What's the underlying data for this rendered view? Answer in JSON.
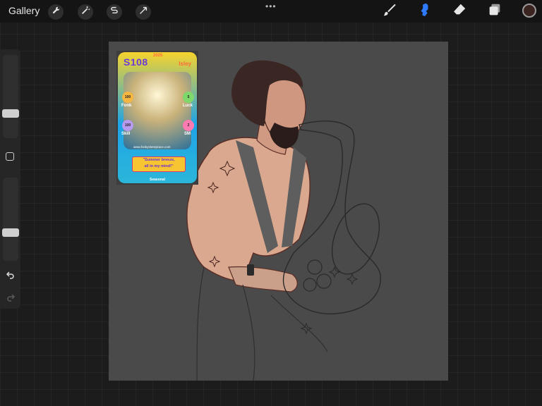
{
  "topbar": {
    "gallery_label": "Gallery",
    "more_dots": "•••"
  },
  "icons": {
    "wrench": "wrench-icon",
    "magic": "magic-wand-icon",
    "selection": "selection-icon",
    "transform": "transform-arrow-icon",
    "brush": "brush-icon",
    "smudge": "smudge-icon",
    "eraser": "eraser-icon",
    "layers": "layers-icon"
  },
  "colors": {
    "active_tool": "#2f7bff",
    "current_color": "#3b2320",
    "canvas": "#4a4a4a"
  },
  "sidebar": {
    "brush_size": 0.55,
    "opacity": 0.65
  },
  "card": {
    "year": "2025",
    "code": "S108",
    "name": "Isley",
    "stats": [
      {
        "value": "100",
        "label": "Fonk",
        "color": "#f5b642"
      },
      {
        "value": "5",
        "label": "Luck",
        "color": "#7fd86b"
      },
      {
        "value": "100",
        "label": "Skill",
        "color": "#b89af0"
      },
      {
        "value": "2",
        "label": "SM",
        "color": "#ff7ab0"
      }
    ],
    "site": "www.fonkystereprace.com",
    "quote_line1": "\"Summer breeze,",
    "quote_line2": "all in my mind!\"",
    "footer": "Seasonal"
  }
}
